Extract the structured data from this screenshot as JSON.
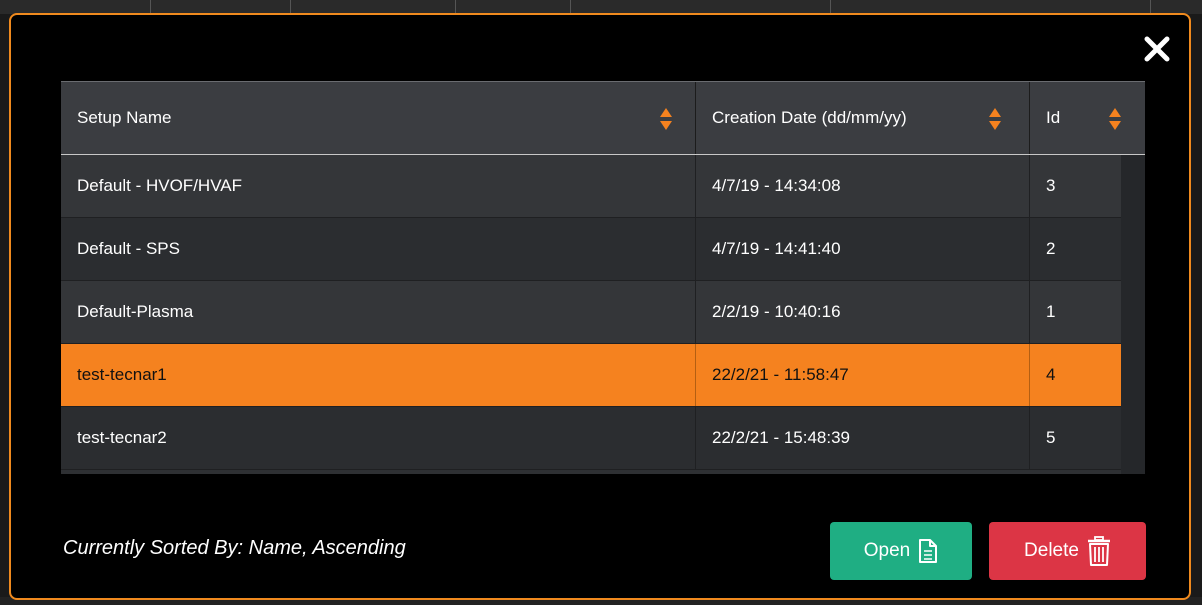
{
  "colors": {
    "accent": "#f5821f",
    "modal_border": "#f08a1e",
    "open_button": "#1fae83",
    "delete_button": "#dc3545"
  },
  "table": {
    "columns": [
      {
        "label": "Setup Name"
      },
      {
        "label": "Creation Date (dd/mm/yy)"
      },
      {
        "label": "Id"
      }
    ],
    "rows": [
      {
        "name": "Default - HVOF/HVAF",
        "date": "4/7/19 - 14:34:08",
        "id": "3",
        "selected": false
      },
      {
        "name": "Default - SPS",
        "date": "4/7/19 - 14:41:40",
        "id": "2",
        "selected": false
      },
      {
        "name": "Default-Plasma",
        "date": "2/2/19 - 10:40:16",
        "id": "1",
        "selected": false
      },
      {
        "name": "test-tecnar1",
        "date": "22/2/21 - 11:58:47",
        "id": "4",
        "selected": true
      },
      {
        "name": "test-tecnar2",
        "date": "22/2/21 - 15:48:39",
        "id": "5",
        "selected": false
      }
    ]
  },
  "footer": {
    "sorted_by": "Currently Sorted By: Name, Ascending",
    "open_label": "Open",
    "delete_label": "Delete"
  },
  "icons": {
    "close": "close-icon",
    "sort": "sort-icon",
    "open": "document-icon",
    "delete": "trash-icon"
  }
}
